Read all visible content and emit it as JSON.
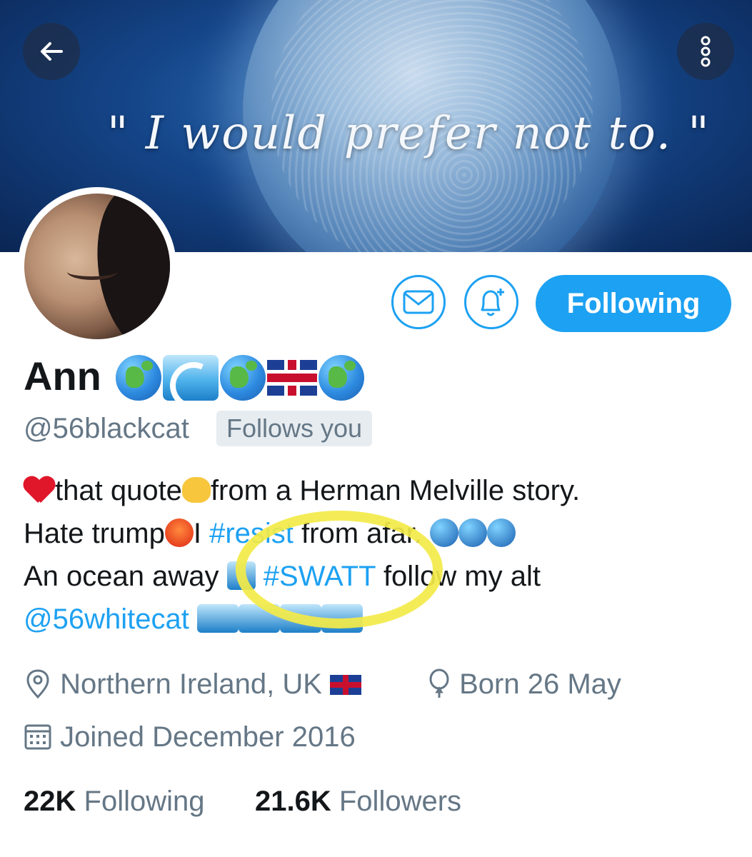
{
  "header": {
    "banner_quote": "\" I would prefer not to.  \"",
    "back_icon": "arrow-left-icon",
    "more_icon": "more-vertical-icon"
  },
  "actions": {
    "message_icon": "envelope-icon",
    "notify_icon": "bell-plus-icon",
    "follow_label": "Following"
  },
  "profile": {
    "name": "Ann",
    "handle": "@56blackcat",
    "follows_you": "Follows you",
    "bio": {
      "line1_a": "that quote",
      "line1_b": "from a Herman Melville story.",
      "line2_a": "Hate trump",
      "line2_b": "I ",
      "line2_tag": "#resist",
      "line2_c": " from afar. ",
      "line3_a": "An ocean away ",
      "line3_tag": "#SWATT",
      "line3_b": " follow my alt",
      "line4_mention": "@56whitecat"
    },
    "location": "Northern Ireland, UK",
    "birthday": "Born 26 May",
    "joined": "Joined December 2016"
  },
  "stats": {
    "following_count": "22K",
    "following_label": "Following",
    "followers_count": "21.6K",
    "followers_label": "Followers"
  },
  "colors": {
    "accent": "#1da1f2",
    "secondary_text": "#657786",
    "highlight": "#f3ea48"
  }
}
